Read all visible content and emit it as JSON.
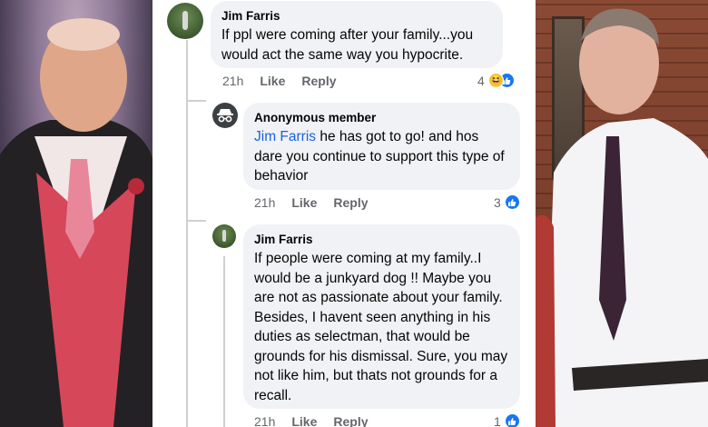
{
  "comments": [
    {
      "author": "Jim Farris",
      "text": "If ppl were coming after your family...you would act the same way you hypocrite.",
      "time": "21h",
      "like_label": "Like",
      "reply_label": "Reply",
      "reaction_count": "4",
      "reactions": [
        "haha-icon",
        "like-icon"
      ]
    },
    {
      "author": "Anonymous member",
      "mention": "Jim Farris",
      "text": " he has got to go! and hos dare you continue to support this type of behavior",
      "time": "21h",
      "like_label": "Like",
      "reply_label": "Reply",
      "reaction_count": "3",
      "reactions": [
        "like-icon"
      ]
    },
    {
      "author": "Jim Farris",
      "text": "If people were coming at my family..I would be a junkyard dog !! Maybe you are not as passionate about your family. Besides, I havent seen anything in his duties as selectman, that would be grounds for his dismissal. Sure, you may not like him, but thats not grounds for a recall.",
      "time": "21h",
      "like_label": "Like",
      "reply_label": "Reply",
      "reaction_count": "1",
      "reactions": [
        "like-icon"
      ]
    }
  ],
  "colors": {
    "bubble": "#f0f2f5",
    "mention": "#1a62e3",
    "like_blue": "#1877f2",
    "meta_gray": "#65676b"
  }
}
